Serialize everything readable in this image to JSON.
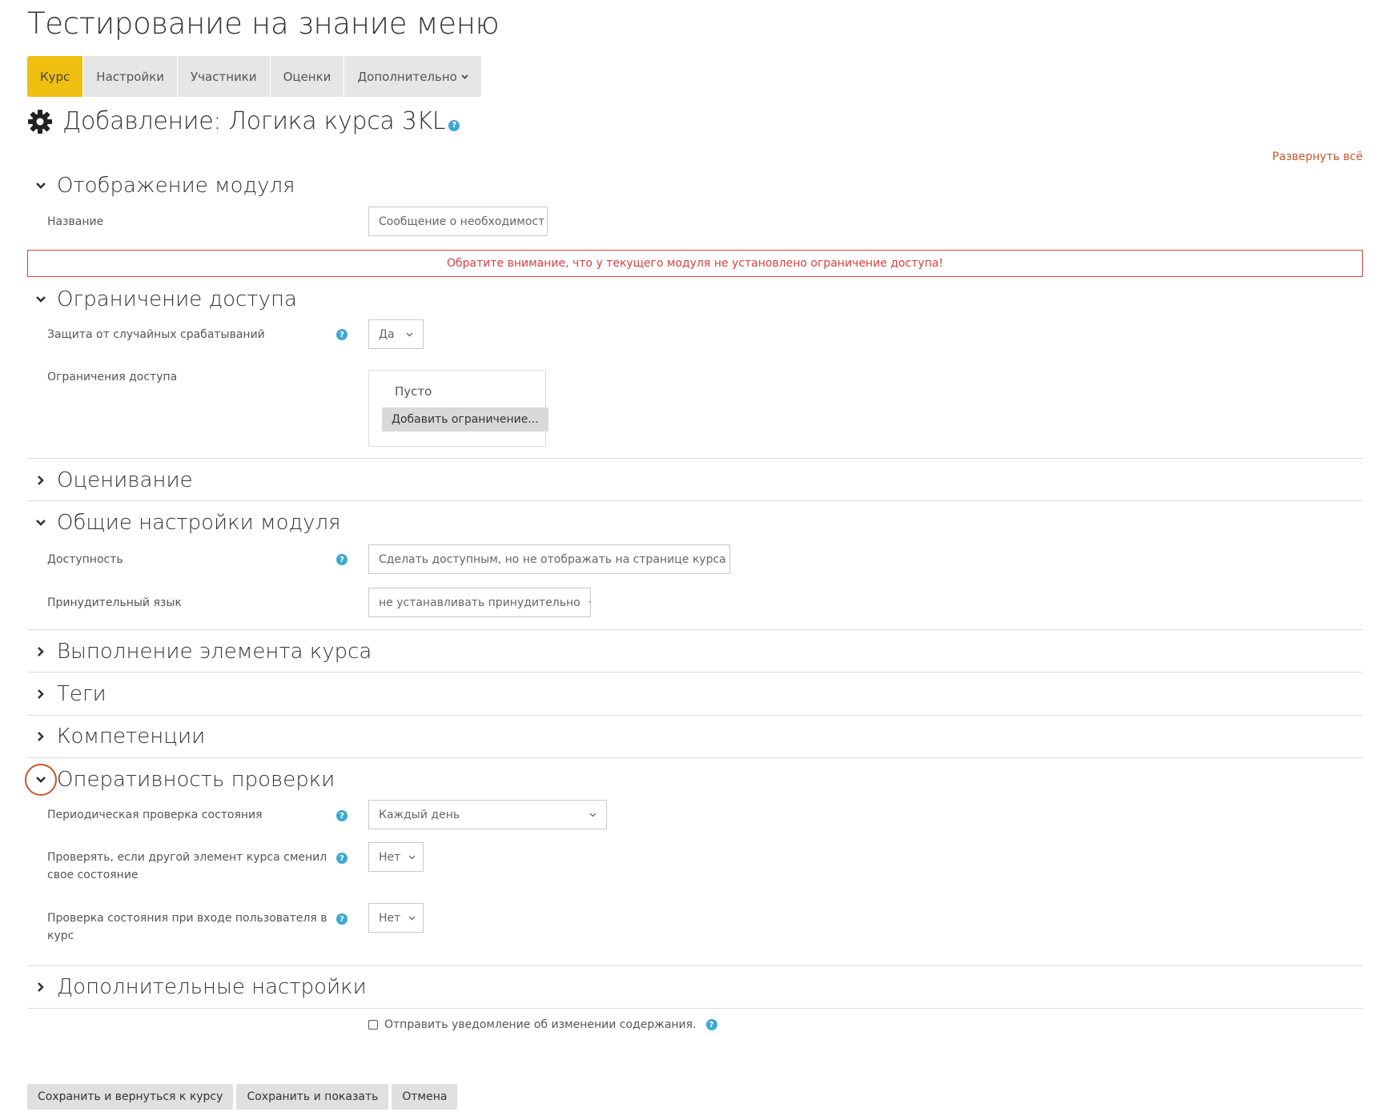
{
  "course": {
    "title": "Тестирование на знание меню"
  },
  "tabs": [
    {
      "label": "Курс"
    },
    {
      "label": "Настройки"
    },
    {
      "label": "Участники"
    },
    {
      "label": "Оценки"
    },
    {
      "label": "Дополнительно"
    }
  ],
  "page": {
    "heading": "Добавление: Логика курса 3KL",
    "expand_all": "Развернуть всё"
  },
  "sections": {
    "display": {
      "title": "Отображение модуля",
      "name_label": "Название",
      "name_value": "Сообщение о необходимост"
    },
    "warning": "Обратите внимание, что у текущего модуля не установлено ограничение доступа!",
    "access": {
      "title": "Ограничение доступа",
      "protect_label": "Защита от случайных срабатываний",
      "protect_value": "Да",
      "restrictions_label": "Ограничения доступа",
      "empty_text": "Пусто",
      "add_button": "Добавить ограничение..."
    },
    "grading": {
      "title": "Оценивание"
    },
    "common": {
      "title": "Общие настройки модуля",
      "availability_label": "Доступность",
      "availability_value": "Сделать доступным, но не отображать на странице курса",
      "language_label": "Принудительный язык",
      "language_value": "не устанавливать принудительно"
    },
    "completion": {
      "title": "Выполнение элемента курса"
    },
    "tags": {
      "title": "Теги"
    },
    "competencies": {
      "title": "Компетенции"
    },
    "check": {
      "title": "Оперативность проверки",
      "periodic_label": "Периодическая проверка состояния",
      "periodic_value": "Каждый день",
      "other_label_1": "Проверять, если другой элемент курса сменил",
      "other_label_2": "свое состояние",
      "other_value": "Нет",
      "login_label_1": "Проверка состояния при входе пользователя в",
      "login_label_2": "курс",
      "login_value": "Нет"
    },
    "advanced": {
      "title": "Дополнительные настройки"
    }
  },
  "notify": {
    "label": "Отправить уведомление об изменении содержания."
  },
  "buttons": {
    "save_return": "Сохранить и вернуться к курсу",
    "save_show": "Сохранить и показать",
    "cancel": "Отмена"
  },
  "help_glyph": "?",
  "colors": {
    "accent": "#f0c010",
    "link": "#c8552d",
    "warning": "#d84040",
    "help": "#3ea9d1"
  }
}
